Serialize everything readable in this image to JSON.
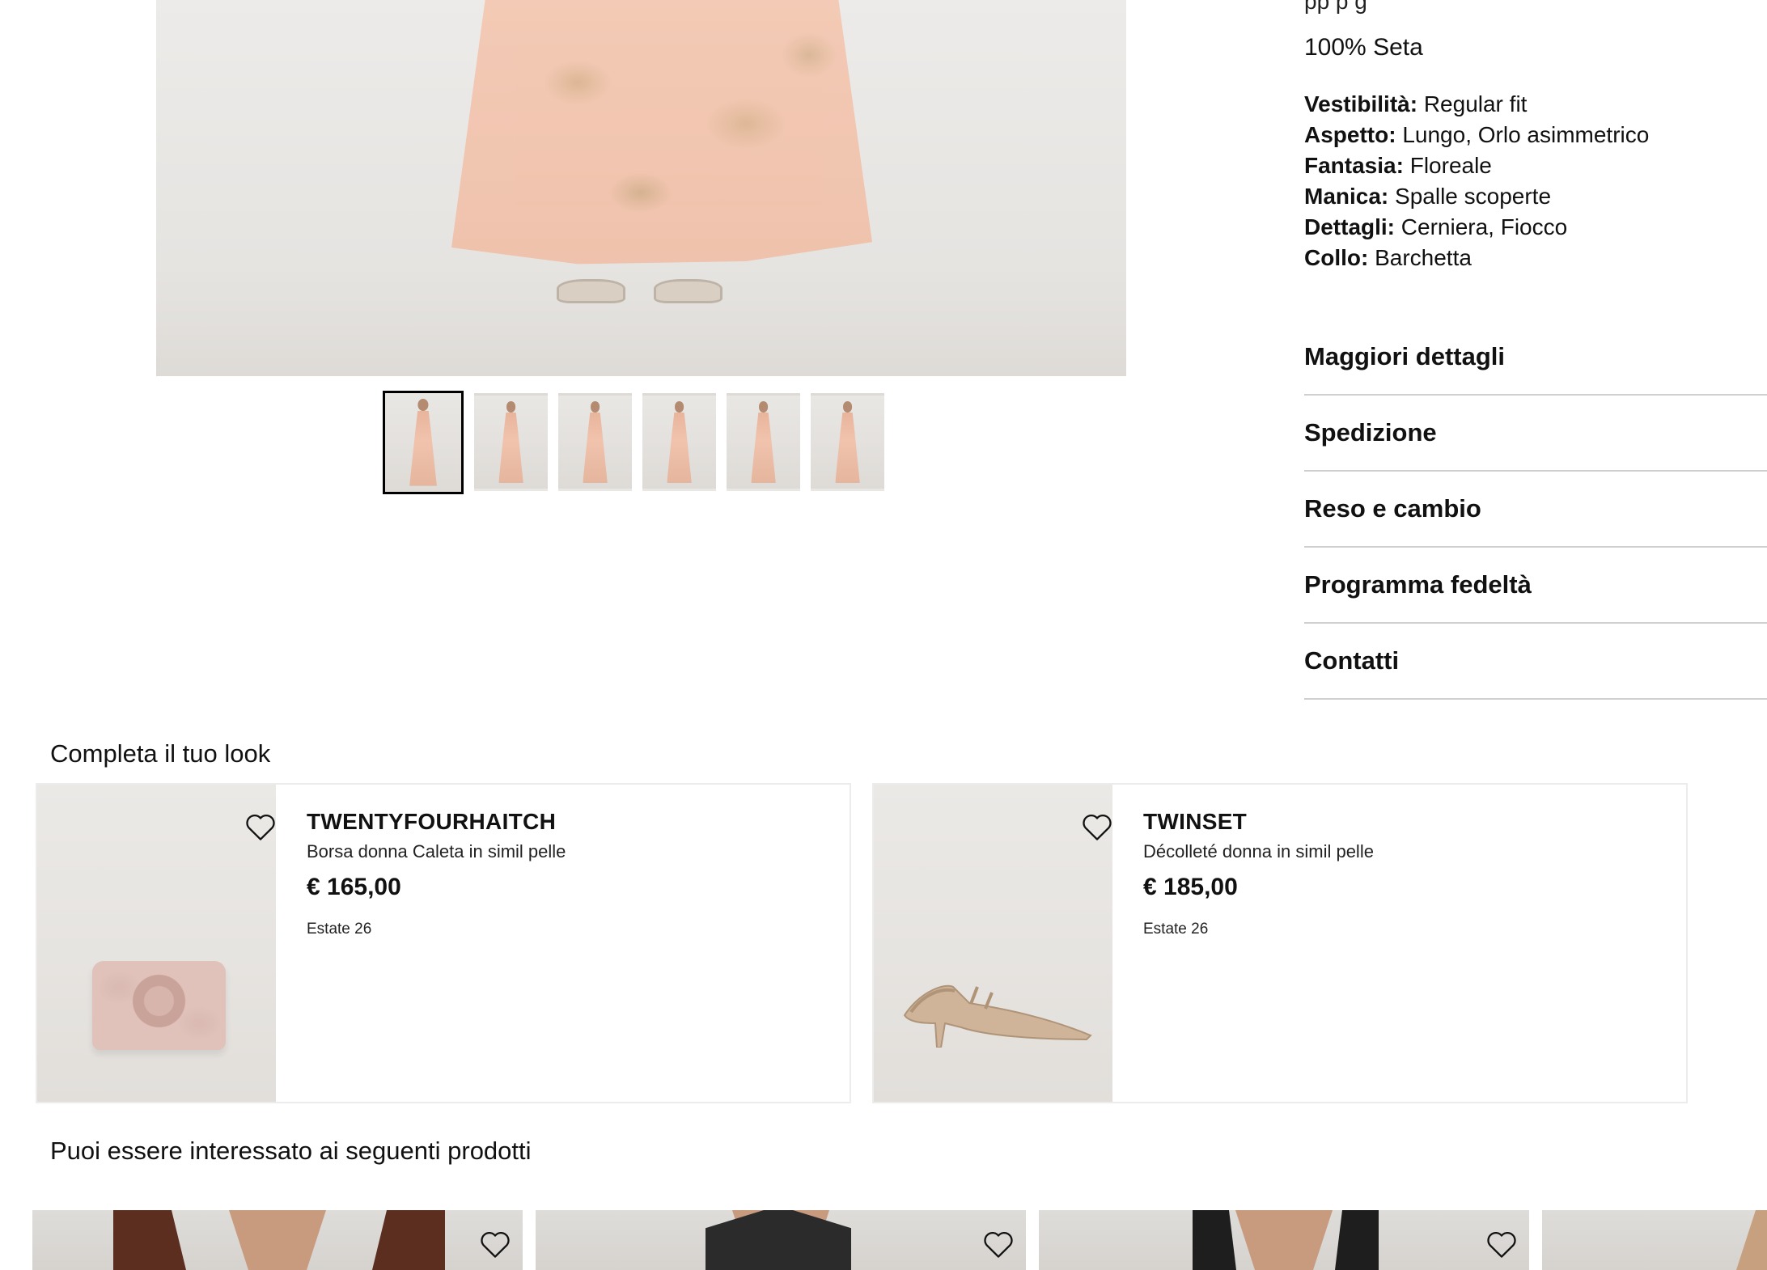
{
  "product": {
    "partial_line": "pp p g",
    "composition": "100% Seta",
    "specs": [
      {
        "key": "Vestibilità:",
        "value": " Regular fit"
      },
      {
        "key": "Aspetto:",
        "value": " Lungo, Orlo asimmetrico"
      },
      {
        "key": "Fantasia:",
        "value": " Floreale"
      },
      {
        "key": "Manica:",
        "value": " Spalle scoperte"
      },
      {
        "key": "Dettagli:",
        "value": " Cerniera, Fiocco"
      },
      {
        "key": "Collo:",
        "value": " Barchetta"
      }
    ],
    "accordion": [
      "Maggiori dettagli",
      "Spedizione",
      "Reso e cambio",
      "Programma fedeltà",
      "Contatti"
    ],
    "thumbnail_count": 6,
    "active_thumbnail": 1
  },
  "complete_look": {
    "title": "Completa il tuo look",
    "items": [
      {
        "brand": "TWENTYFOURHAITCH",
        "description": "Borsa donna Caleta in simil pelle",
        "price": "€ 165,00",
        "season": "Estate 26",
        "image": "pink-rose-clutch",
        "icon": "heart-icon"
      },
      {
        "brand": "TWINSET",
        "description": "Décolleté donna in simil pelle",
        "price": "€ 185,00",
        "season": "Estate 26",
        "image": "nude-slingback-pump",
        "icon": "heart-icon"
      }
    ]
  },
  "recommended": {
    "title": "Puoi essere interessato ai seguenti prodotti",
    "items": [
      {
        "image": "brown-vest-top",
        "color": "#5b2e1f",
        "icon": "heart-icon"
      },
      {
        "image": "black-shirt",
        "color": "#2b2b2b",
        "icon": "heart-icon"
      },
      {
        "image": "black-tank-top",
        "color": "#1e1e1e",
        "icon": "heart-icon"
      },
      {
        "image": "beige-top",
        "color": "#c7a07f",
        "icon": "heart-icon"
      }
    ]
  },
  "colors": {
    "text": "#111111",
    "divider": "#cfcfcf",
    "card_border": "#ececec",
    "image_bg": "#e6e4e1"
  }
}
